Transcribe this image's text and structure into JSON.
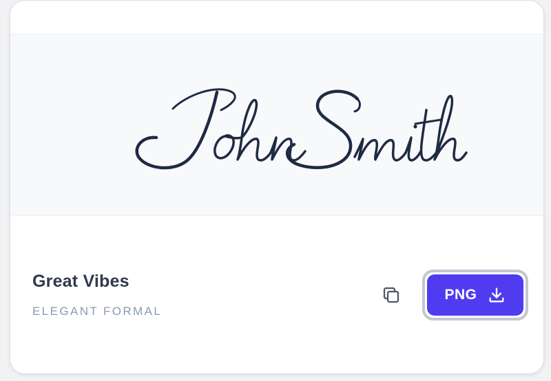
{
  "card": {
    "preview": {
      "signature_text": "John Smith",
      "ink_color": "#1f2a44",
      "background_color": "#f7f9fb"
    },
    "font_name": "Great Vibes",
    "font_category": "ELEGANT FORMAL",
    "actions": {
      "copy_icon": "copy-icon",
      "png_label": "PNG",
      "png_icon": "download-icon",
      "accent_color": "#4f3cf0"
    }
  }
}
